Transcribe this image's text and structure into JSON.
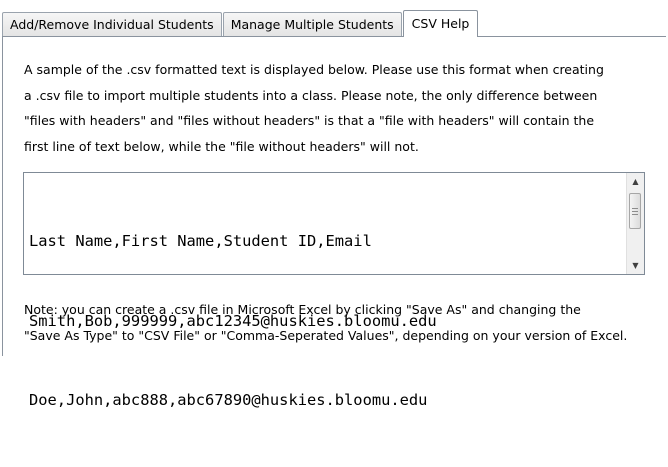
{
  "tabs": [
    {
      "label": "Add/Remove Individual Students",
      "active": false
    },
    {
      "label": "Manage Multiple Students",
      "active": false
    },
    {
      "label": "CSV Help",
      "active": true
    }
  ],
  "intro_lines": [
    "A sample of the .csv formatted text is displayed below.  Please use this format when creating",
    "a .csv file to import multiple students into a class. Please note, the only difference between",
    "\"files with headers\" and \"files without headers\" is that a \"file with headers\" will contain the",
    "first line of text below, while the \"file without headers\" will not."
  ],
  "csv_sample_lines": [
    "Last Name,First Name,Student ID,Email",
    "Smith,Bob,999999,abc12345@huskies.bloomu.edu",
    "Doe,John,abc888,abc67890@huskies.bloomu.edu"
  ],
  "note_lines": [
    "Note: you can create a .csv file in Microsoft Excel by clicking \"Save As\" and changing the",
    "\"Save As Type\" to \"CSV File\" or \"Comma-Seperated Values\", depending on your version of Excel."
  ],
  "icons": {
    "scroll_up": "scroll-up-arrow",
    "scroll_down": "scroll-down-arrow"
  },
  "colors": {
    "border": "#8a939e",
    "tab_inactive": "#e3e3e3",
    "panel_bg": "#ffffff"
  }
}
